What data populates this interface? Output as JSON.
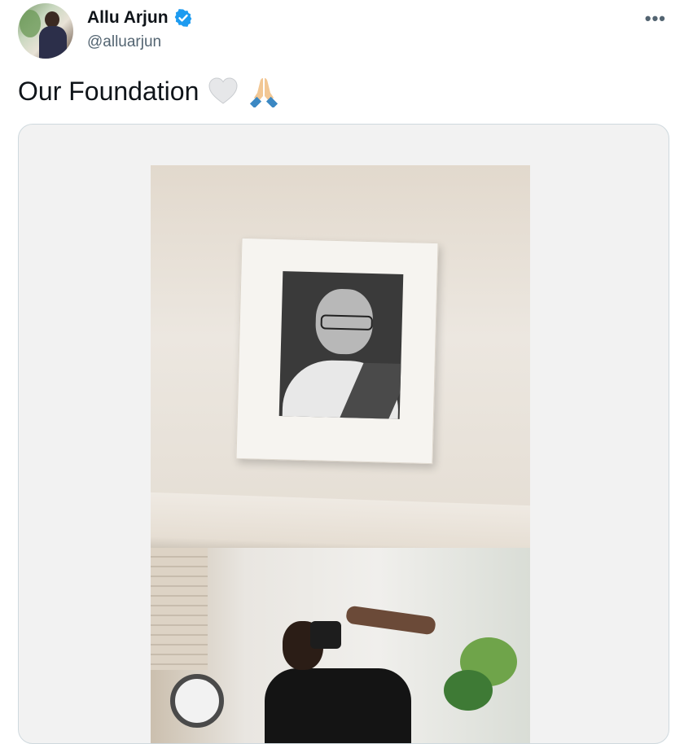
{
  "author": {
    "name": "Allu Arjun",
    "handle": "@alluarjun",
    "verified_icon": "verified-badge-icon",
    "avatar_icon": "profile-photo"
  },
  "more_icon": "more-horizontal-icon",
  "more_label": "•••",
  "tweet": {
    "text": "Our Foundation",
    "emojis": [
      "white-heart-icon",
      "folded-hands-icon"
    ]
  },
  "media": {
    "icon": "photo-framed-portrait-mirror-selfie",
    "accent": "#1d9bf0"
  }
}
